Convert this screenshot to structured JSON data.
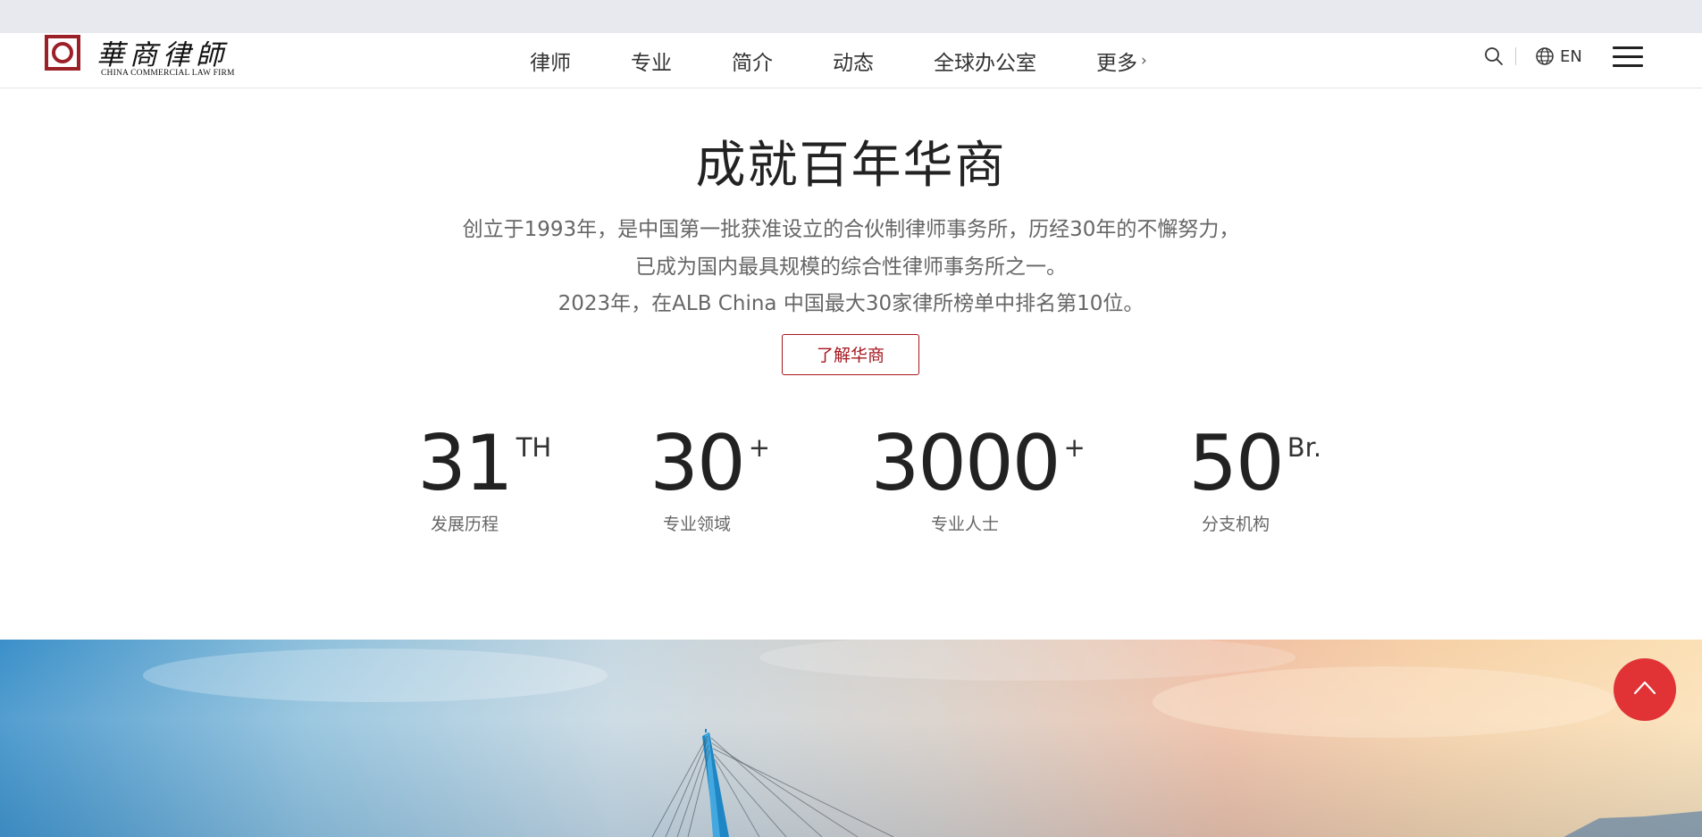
{
  "colors": {
    "brand": "#9b2027",
    "accent": "#a6171f",
    "back_to_top": "#e13335"
  },
  "logo": {
    "cn": "華商律師",
    "en": "CHINA COMMERCIAL LAW FIRM"
  },
  "nav": {
    "items": [
      "律师",
      "专业",
      "简介",
      "动态",
      "全球办公室",
      "更多"
    ]
  },
  "header": {
    "lang_label": "EN",
    "icons": [
      "search-icon",
      "globe-icon",
      "menu-icon"
    ]
  },
  "intro": {
    "title": "成就百年华商",
    "lines": [
      "创立于1993年，是中国第一批获准设立的合伙制律师事务所，历经30年的不懈努力，",
      "已成为国内最具规模的综合性律师事务所之一。",
      "2023年，在ALB China 中国最大30家律所榜单中排名第10位。"
    ],
    "cta_label": "了解华商"
  },
  "stats": [
    {
      "value": "31",
      "sup": "TH",
      "label": "发展历程"
    },
    {
      "value": "30",
      "sup": "+",
      "label": "专业领域"
    },
    {
      "value": "3000",
      "sup": "+",
      "label": "专业人士"
    },
    {
      "value": "50",
      "sup": "Br.",
      "label": "分支机构"
    }
  ]
}
